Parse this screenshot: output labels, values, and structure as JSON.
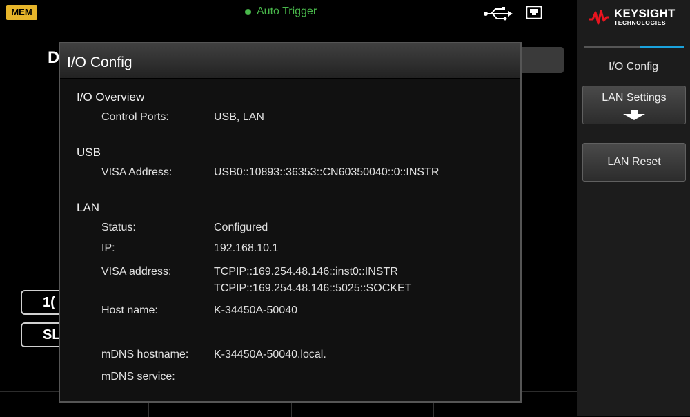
{
  "status_bar": {
    "mem_label": "MEM",
    "trigger_label": "Auto Trigger",
    "accent_green": "#49b84b",
    "mem_color": "#e7b52a"
  },
  "background": {
    "display_text": "D",
    "button1_text": "1(",
    "button2_text": "SL"
  },
  "dialog": {
    "title": "I/O Config",
    "sections": {
      "overview_title": "I/O Overview",
      "control_ports_label": "Control Ports:",
      "control_ports_value": "USB, LAN",
      "usb_title": "USB",
      "usb_visa_label": "VISA Address:",
      "usb_visa_value": "USB0::10893::36353::CN60350040::0::INSTR",
      "lan_title": "LAN",
      "status_label": "Status:",
      "status_value": "Configured",
      "ip_label": "IP:",
      "ip_value": "192.168.10.1",
      "lan_visa_label": "VISA address:",
      "lan_visa_value_1": "TCPIP::169.254.48.146::inst0::INSTR",
      "lan_visa_value_2": "TCPIP::169.254.48.146::5025::SOCKET",
      "host_label": "Host name:",
      "host_value": "K-34450A-50040",
      "mdns_host_label": "mDNS hostname:",
      "mdns_host_value": "K-34450A-50040.local.",
      "mdns_service_label": "mDNS service:"
    }
  },
  "softkeys": {
    "brand": "KEYSIGHT",
    "brand_sub": "TECHNOLOGIES",
    "menu_title": "I/O Config",
    "lan_settings": "LAN Settings",
    "lan_reset": "LAN Reset",
    "accent_blue": "#1aa2dc",
    "brand_red": "#e8141f"
  }
}
